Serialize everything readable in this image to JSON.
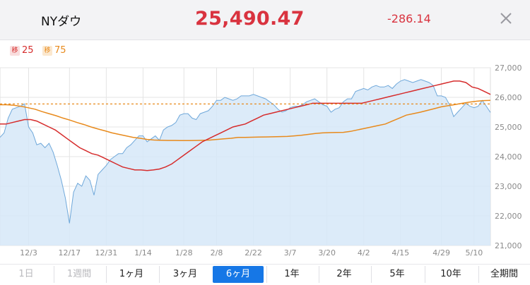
{
  "header": {
    "title": "NYダウ",
    "price": "25,490.47",
    "change": "-286.14",
    "close_icon": "close-icon",
    "price_color": "#d9333f"
  },
  "legend": [
    {
      "badge": "移",
      "label": "25",
      "color": "#d62c2c",
      "badge_bg": "#f9dede"
    },
    {
      "badge": "移",
      "label": "75",
      "color": "#e88a1c",
      "badge_bg": "#fbe8cf"
    }
  ],
  "tabs": [
    {
      "label": "1日",
      "state": "disabled"
    },
    {
      "label": "1週間",
      "state": "disabled"
    },
    {
      "label": "1ヶ月",
      "state": "normal"
    },
    {
      "label": "3ヶ月",
      "state": "normal"
    },
    {
      "label": "6ヶ月",
      "state": "active"
    },
    {
      "label": "1年",
      "state": "normal"
    },
    {
      "label": "2年",
      "state": "normal"
    },
    {
      "label": "5年",
      "state": "normal"
    },
    {
      "label": "10年",
      "state": "normal"
    },
    {
      "label": "全期間",
      "state": "normal"
    }
  ],
  "chart_data": {
    "type": "area",
    "y_axis_position": "right",
    "ylim": [
      21000,
      27000
    ],
    "yticks": [
      21000,
      22000,
      23000,
      24000,
      25000,
      26000,
      27000
    ],
    "ytick_labels": [
      "21,000",
      "22,000",
      "23,000",
      "24,000",
      "25,000",
      "26,000",
      "27,000"
    ],
    "x_tick_labels": [
      {
        "label": "12/3",
        "i": 7
      },
      {
        "label": "12/17",
        "i": 17
      },
      {
        "label": "12/31",
        "i": 26
      },
      {
        "label": "1/14",
        "i": 35
      },
      {
        "label": "1/28",
        "i": 45
      },
      {
        "label": "2/8",
        "i": 53
      },
      {
        "label": "2/22",
        "i": 62
      },
      {
        "label": "3/7",
        "i": 71
      },
      {
        "label": "3/20",
        "i": 80
      },
      {
        "label": "4/2",
        "i": 89
      },
      {
        "label": "4/15",
        "i": 98
      },
      {
        "label": "4/29",
        "i": 108
      },
      {
        "label": "5/10",
        "i": 116
      }
    ],
    "grid": true,
    "reference_line": 25776,
    "colors": {
      "area_fill": "#d6e7f8",
      "area_line": "#6fa8da",
      "ma25": "#d62c2c",
      "ma75": "#e88a1c",
      "reference": "#e88a1c"
    },
    "series": [
      {
        "name": "",
        "values": [
          24650,
          24800,
          25300,
          25600,
          25650,
          25700,
          25780,
          25000,
          24800,
          24400,
          24450,
          24300,
          24450,
          24150,
          23700,
          23200,
          22600,
          21750,
          22800,
          23100,
          23000,
          23350,
          23200,
          22700,
          23400,
          23550,
          23700,
          23900,
          24000,
          24100,
          24100,
          24300,
          24400,
          24550,
          24700,
          24700,
          24500,
          24600,
          24700,
          24550,
          24900,
          25000,
          25050,
          25150,
          25400,
          25450,
          25450,
          25300,
          25250,
          25450,
          25500,
          25550,
          25700,
          25900,
          25900,
          26000,
          25950,
          25900,
          25950,
          26050,
          26050,
          26050,
          26100,
          26050,
          26000,
          25950,
          25850,
          25750,
          25600,
          25500,
          25550,
          25650,
          25700,
          25700,
          25750,
          25850,
          25900,
          25950,
          25850,
          25750,
          25700,
          25500,
          25600,
          25650,
          25850,
          25950,
          25950,
          26200,
          26250,
          26300,
          26250,
          26350,
          26400,
          26350,
          26350,
          26400,
          26300,
          26450,
          26550,
          26600,
          26550,
          26500,
          26550,
          26600,
          26550,
          26500,
          26400,
          26050,
          26050,
          26000,
          25750,
          25350,
          25500,
          25650,
          25800,
          25700,
          25650,
          25700,
          25900,
          25700,
          25490
        ]
      },
      {
        "name": "25",
        "values": [
          25100,
          25100,
          25150,
          25200,
          25250,
          25250,
          25200,
          25100,
          25000,
          24900,
          24750,
          24600,
          24450,
          24300,
          24200,
          24100,
          24050,
          23950,
          23850,
          23750,
          23650,
          23600,
          23550,
          23550,
          23530,
          23550,
          23580,
          23650,
          23750,
          23900,
          24050,
          24200,
          24350,
          24500,
          24600,
          24700,
          24800,
          24900,
          25000,
          25050,
          25100,
          25200,
          25300,
          25400,
          25450,
          25500,
          25550,
          25600,
          25650,
          25700,
          25750,
          25800,
          25800,
          25800,
          25800,
          25800,
          25800,
          25800,
          25800,
          25800,
          25850,
          25900,
          25950,
          26000,
          26050,
          26100,
          26150,
          26200,
          26250,
          26300,
          26350,
          26400,
          26450,
          26500,
          26550,
          26550,
          26500,
          26350,
          26300,
          26200,
          26100
        ]
      },
      {
        "name": "75",
        "values": [
          25750,
          25750,
          25730,
          25700,
          25650,
          25600,
          25520,
          25450,
          25380,
          25300,
          25230,
          25150,
          25080,
          25000,
          24930,
          24870,
          24800,
          24750,
          24700,
          24650,
          24620,
          24580,
          24560,
          24550,
          24545,
          24545,
          24540,
          24540,
          24545,
          24550,
          24560,
          24580,
          24600,
          24620,
          24650,
          24650,
          24655,
          24660,
          24665,
          24670,
          24675,
          24680,
          24700,
          24720,
          24750,
          24780,
          24800,
          24810,
          24815,
          24820,
          24850,
          24900,
          24950,
          25000,
          25050,
          25100,
          25200,
          25300,
          25400,
          25450,
          25500,
          25560,
          25620,
          25680,
          25720,
          25760,
          25800,
          25840,
          25870,
          25890,
          25900
        ]
      }
    ]
  }
}
